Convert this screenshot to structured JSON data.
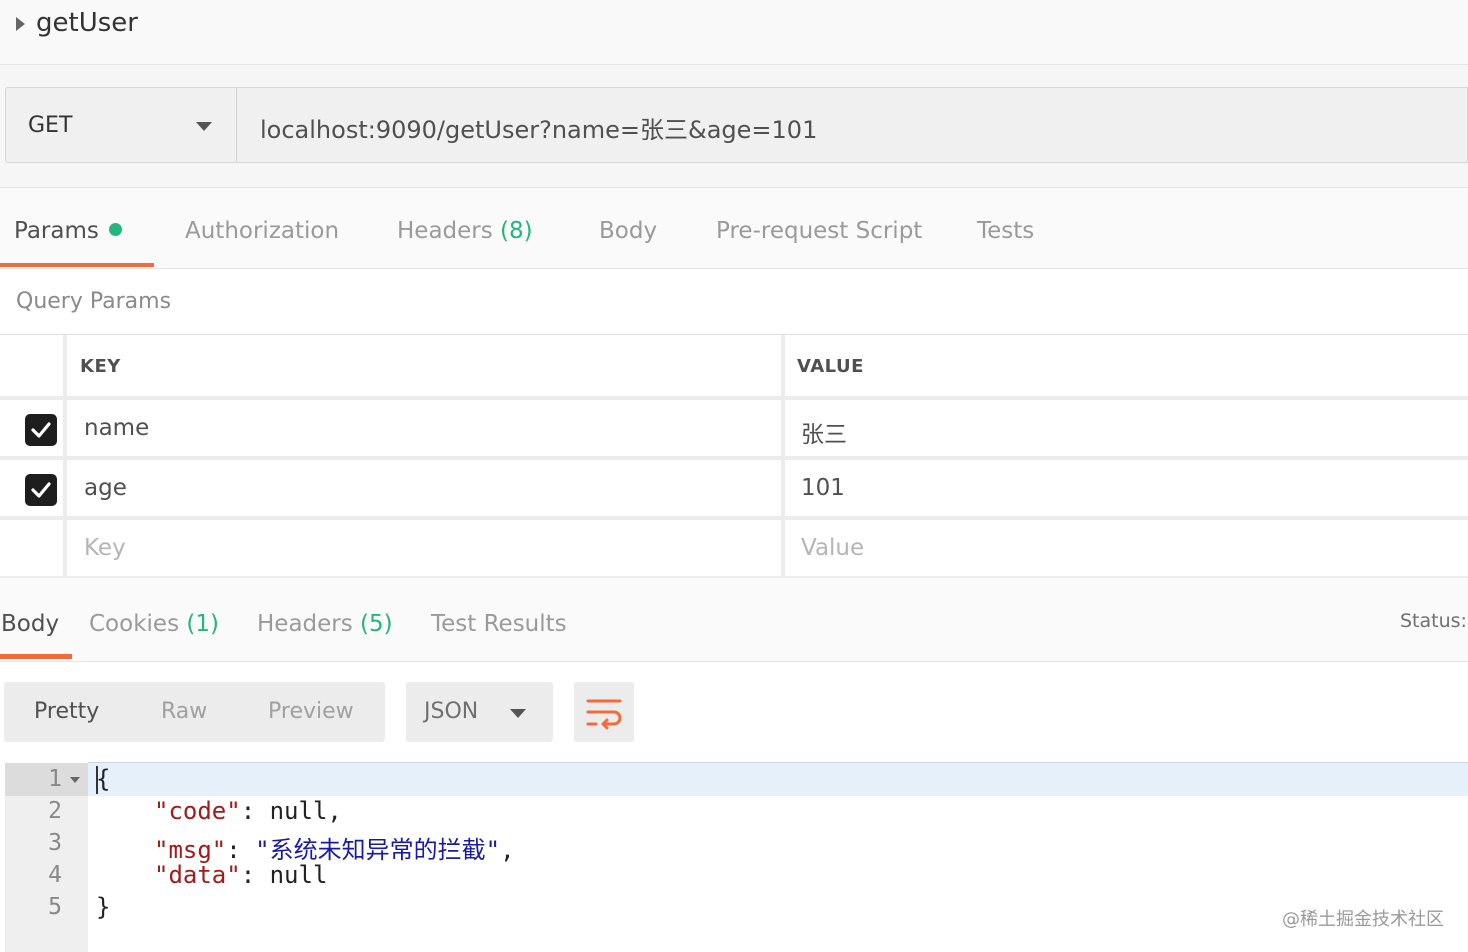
{
  "request": {
    "name": "getUser",
    "method": "GET",
    "url": "localhost:9090/getUser?name=张三&age=101"
  },
  "request_tabs": {
    "params": "Params",
    "authorization": "Authorization",
    "headers": "Headers",
    "headers_count": "(8)",
    "body": "Body",
    "prerequest": "Pre-request Script",
    "tests": "Tests"
  },
  "query_params": {
    "title": "Query Params",
    "col_key": "KEY",
    "col_value": "VALUE",
    "rows": [
      {
        "key": "name",
        "value": "张三",
        "checked": true
      },
      {
        "key": "age",
        "value": "101",
        "checked": true
      }
    ],
    "placeholder_key": "Key",
    "placeholder_value": "Value"
  },
  "response_tabs": {
    "body": "Body",
    "cookies": "Cookies",
    "cookies_count": "(1)",
    "headers": "Headers",
    "headers_count": "(5)",
    "test_results": "Test Results",
    "status": "Status:"
  },
  "format": {
    "pretty": "Pretty",
    "raw": "Raw",
    "preview": "Preview",
    "language": "JSON"
  },
  "code": {
    "line_numbers": [
      "1",
      "2",
      "3",
      "4",
      "5"
    ],
    "open_brace": "{",
    "close_brace": "}",
    "code_key": "\"code\"",
    "code_val": ": null,",
    "msg_key": "\"msg\"",
    "msg_sep": ": ",
    "msg_val": "\"系统未知异常的拦截\"",
    "msg_tail": ",",
    "data_key": "\"data\"",
    "data_val": ": null"
  },
  "watermark": "@稀土掘金技术社区",
  "colors": {
    "accent": "#f26b3a",
    "count_green": "#26b47f",
    "json_key": "#a11b1b",
    "json_string": "#1a1aa6"
  }
}
